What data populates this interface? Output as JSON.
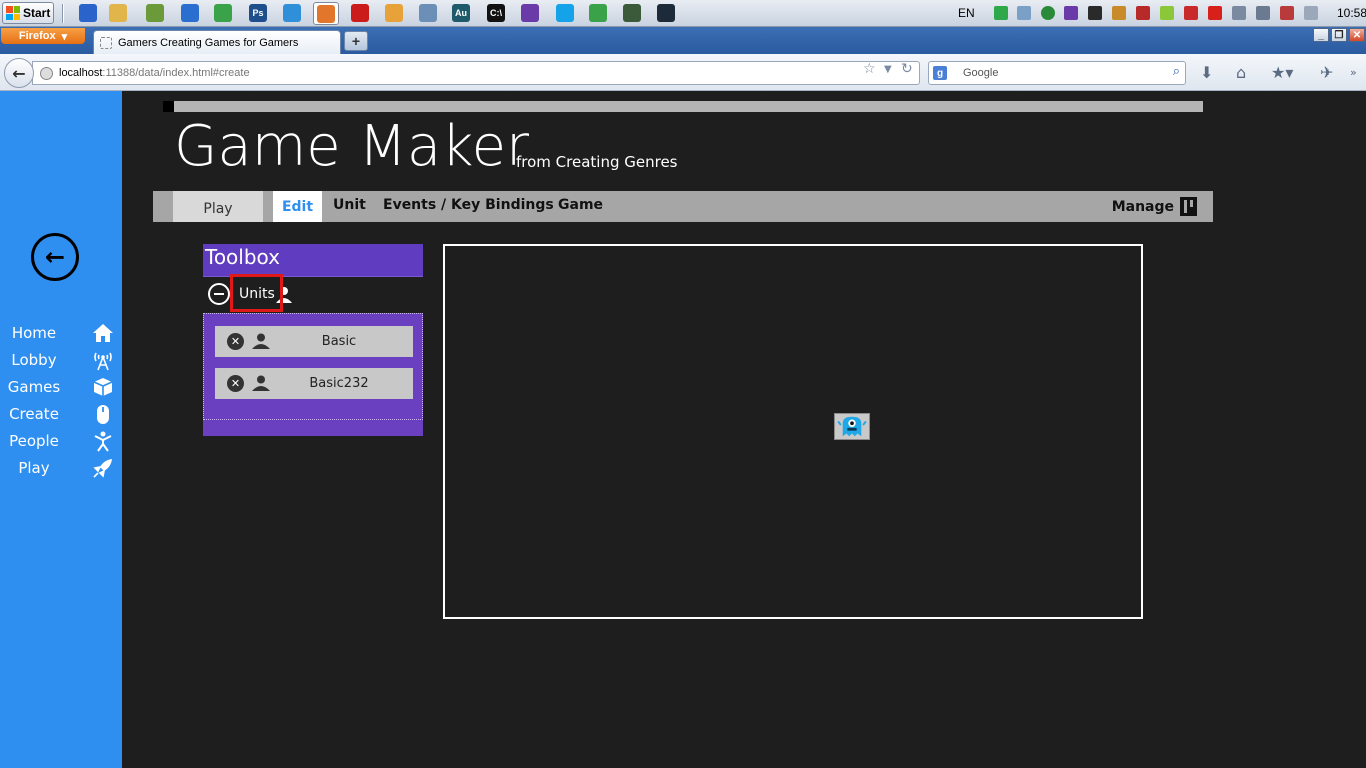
{
  "taskbar": {
    "start_label": "Start",
    "language": "EN",
    "clock": "10:58",
    "app_icons": [
      {
        "name": "remote-icon",
        "color": "#2a63c9"
      },
      {
        "name": "folder-icon",
        "color": "#e2b54a"
      },
      {
        "name": "notepad-icon",
        "color": "#6a9a3a"
      },
      {
        "name": "network-icon",
        "color": "#2a6fd0"
      },
      {
        "name": "chrome-icon",
        "color": "#3aa34a"
      },
      {
        "name": "photoshop-icon",
        "color": "#1f4e8c",
        "text": "Ps"
      },
      {
        "name": "ie-icon",
        "color": "#2f8fd8"
      },
      {
        "name": "firefox-icon",
        "color": "#e2762a"
      },
      {
        "name": "opera-icon",
        "color": "#cc1b1b"
      },
      {
        "name": "paint-icon",
        "color": "#e8a23a"
      },
      {
        "name": "globe-icon",
        "color": "#6c8fb8"
      },
      {
        "name": "audition-icon",
        "color": "#1e5a6a",
        "text": "Au"
      },
      {
        "name": "cmd-icon",
        "color": "#111111",
        "text": "C:\\"
      },
      {
        "name": "visual-studio-icon",
        "color": "#6a3aa8"
      },
      {
        "name": "skype-icon",
        "color": "#14a3e8"
      },
      {
        "name": "chrome-alt-icon",
        "color": "#3aa34a"
      },
      {
        "name": "monitor-icon",
        "color": "#3a5a3a"
      },
      {
        "name": "steam-icon",
        "color": "#1c2a3a"
      }
    ]
  },
  "browser": {
    "menu_label": "Firefox",
    "tab_title": "Gamers Creating Games for Gamers",
    "new_tab_label": "+",
    "url_host": "localhost",
    "url_path": ":11388/data/index.html#create",
    "search_engine": "Google",
    "search_placeholder": "Google"
  },
  "sidebar": {
    "items": [
      {
        "label": "Home",
        "icon": "home-icon"
      },
      {
        "label": "Lobby",
        "icon": "antenna-icon"
      },
      {
        "label": "Games",
        "icon": "cube-icon"
      },
      {
        "label": "Create",
        "icon": "mouse-icon"
      },
      {
        "label": "People",
        "icon": "person-icon"
      },
      {
        "label": "Play",
        "icon": "rocket-icon"
      }
    ]
  },
  "page": {
    "title": "Game Maker",
    "subtitle": "from Creating Genres",
    "progress": 0.011
  },
  "nav": {
    "play": "Play",
    "edit": "Edit",
    "unit": "Unit",
    "events": "Events / Key Bindings",
    "game": "Game",
    "manage": "Manage"
  },
  "toolbox": {
    "title": "Toolbox",
    "section_label": "Units",
    "units": [
      {
        "name": "Basic"
      },
      {
        "name": "Basic232"
      }
    ]
  },
  "colors": {
    "sidebar": "#2f8ff0",
    "toolbox": "#6a3fc0",
    "highlight": "#e01818",
    "background": "#1e1e1e"
  }
}
